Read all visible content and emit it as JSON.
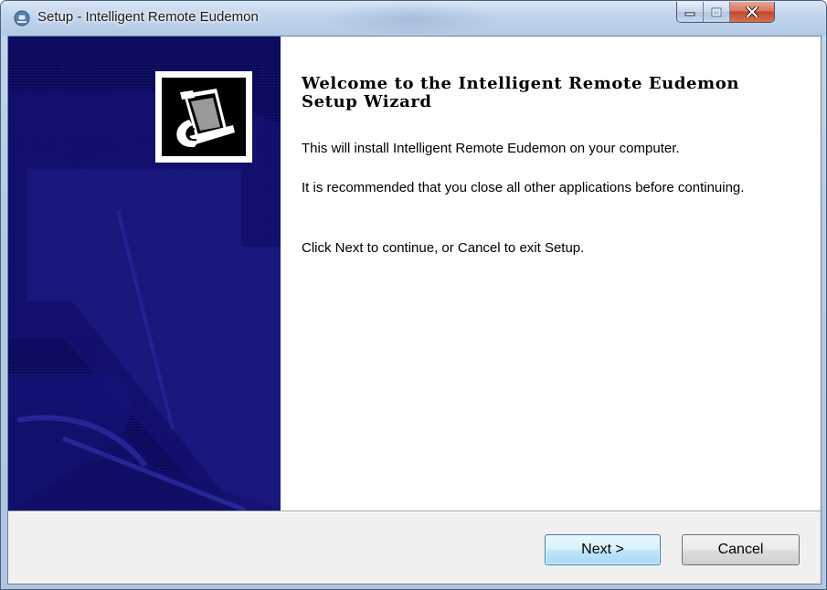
{
  "window": {
    "title": "Setup - Intelligent Remote Eudemon",
    "caption_buttons": [
      "minimize-icon",
      "maximize-icon",
      "close-icon"
    ]
  },
  "wizard": {
    "heading": "Welcome to the Intelligent Remote Eudemon Setup Wizard",
    "paragraphs": [
      "This will install Intelligent Remote Eudemon on your computer.",
      "It is recommended that you close all other applications before continuing.",
      "Click Next to continue, or Cancel to exit Setup."
    ],
    "logo_icon": "installer-computer-icon"
  },
  "buttons": {
    "next_label": "Next >",
    "cancel_label": "Cancel"
  },
  "colors": {
    "sidebar": "#0b0b5c",
    "default_button_border": "#3c7fb1",
    "close_button": "#c1472b"
  }
}
